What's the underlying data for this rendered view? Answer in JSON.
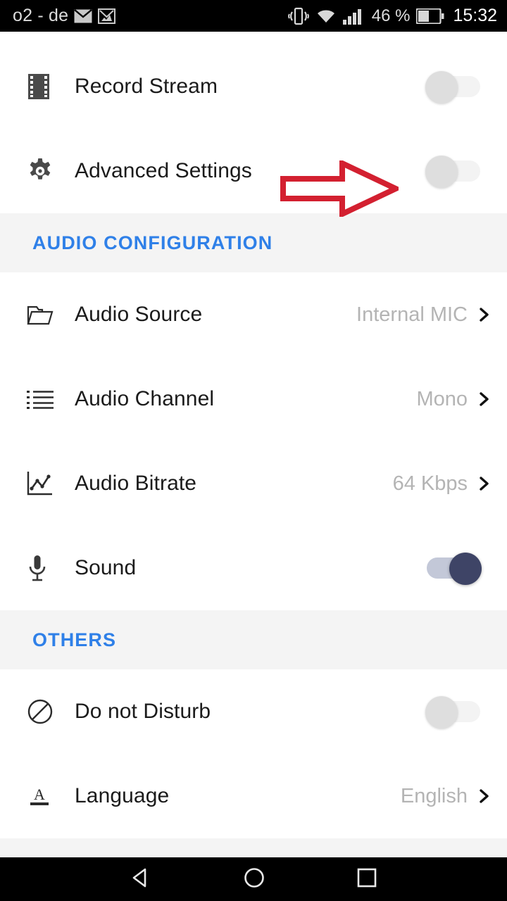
{
  "status_bar": {
    "carrier": "o2 - de",
    "icons_left": [
      "envelope-icon",
      "gmail-icon"
    ],
    "icons_right": [
      "vibrate-icon",
      "wifi-icon",
      "signal-bars-icon",
      "battery-icon"
    ],
    "battery_percent": "46 %",
    "clock": "15:32"
  },
  "top_section": {
    "rows": [
      {
        "icon": "film-strip-icon",
        "label": "Record Stream",
        "control": "toggle",
        "state": "off"
      },
      {
        "icon": "gear-icon",
        "label": "Advanced Settings",
        "control": "toggle",
        "state": "off"
      }
    ]
  },
  "audio_section": {
    "header": "AUDIO CONFIGURATION",
    "rows": [
      {
        "icon": "folder-icon",
        "label": "Audio Source",
        "value": "Internal MIC",
        "control": "chevron"
      },
      {
        "icon": "list-icon",
        "label": "Audio Channel",
        "value": "Mono",
        "control": "chevron"
      },
      {
        "icon": "chart-icon",
        "label": "Audio Bitrate",
        "value": "64 Kbps",
        "control": "chevron"
      },
      {
        "icon": "microphone-icon",
        "label": "Sound",
        "control": "toggle",
        "state": "on"
      }
    ]
  },
  "others_section": {
    "header": "OTHERS",
    "rows": [
      {
        "icon": "do-not-disturb-icon",
        "label": "Do not Disturb",
        "control": "toggle",
        "state": "off"
      },
      {
        "icon": "font-icon",
        "label": "Language",
        "value": "English",
        "control": "chevron"
      }
    ]
  },
  "annotation": {
    "type": "arrow-right",
    "color": "#d32030",
    "points_at": "Advanced Settings toggle"
  },
  "nav_bar": {
    "buttons": [
      "back-triangle-icon",
      "home-circle-icon",
      "recents-square-icon"
    ]
  },
  "colors": {
    "accent_blue": "#2f80e8",
    "annotation_red": "#d32030",
    "toggle_on_knob": "#3e4466",
    "page_background": "#f4f4f4",
    "card_background": "#ffffff"
  }
}
